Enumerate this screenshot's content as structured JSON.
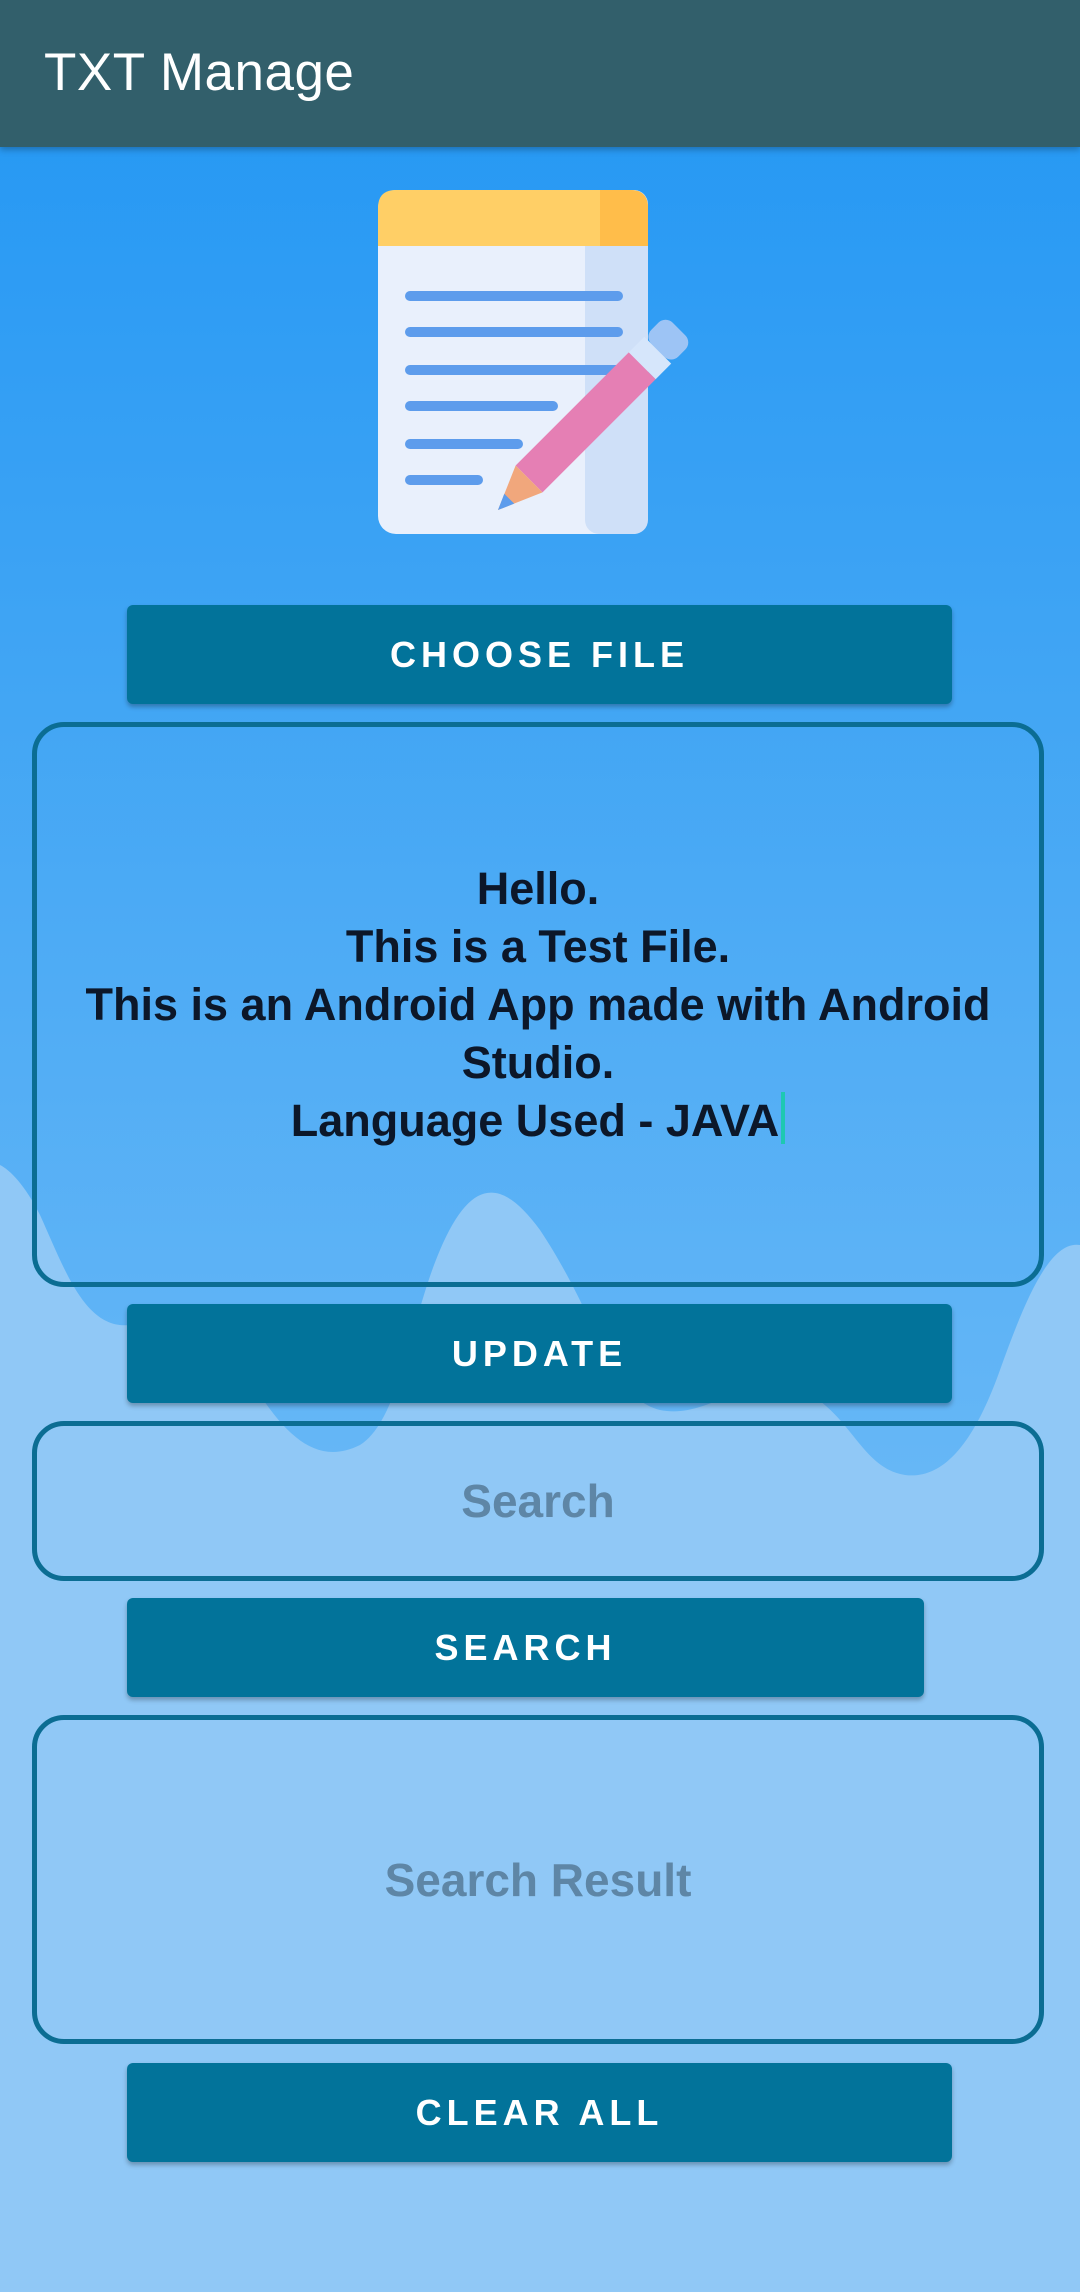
{
  "app_bar": {
    "title": "TXT Manage"
  },
  "logo": {
    "icon": "notepad-pencil-icon"
  },
  "buttons": {
    "choose_file": "CHOOSE FILE",
    "update": "UPDATE",
    "search": "SEARCH",
    "clear_all": "CLEAR ALL"
  },
  "editor": {
    "content": "Hello.\nThis is a Test File.\nThis is an Android App made with Android Studio.\nLanguage Used - JAVA"
  },
  "search_input": {
    "placeholder": "Search",
    "value": ""
  },
  "search_result": {
    "placeholder": "Search Result"
  },
  "colors": {
    "app_bar": "#325f6b",
    "button": "#02739a",
    "background_top": "#2196f3",
    "background_bottom": "#90c8f6",
    "box_border": "#0b6d93"
  }
}
